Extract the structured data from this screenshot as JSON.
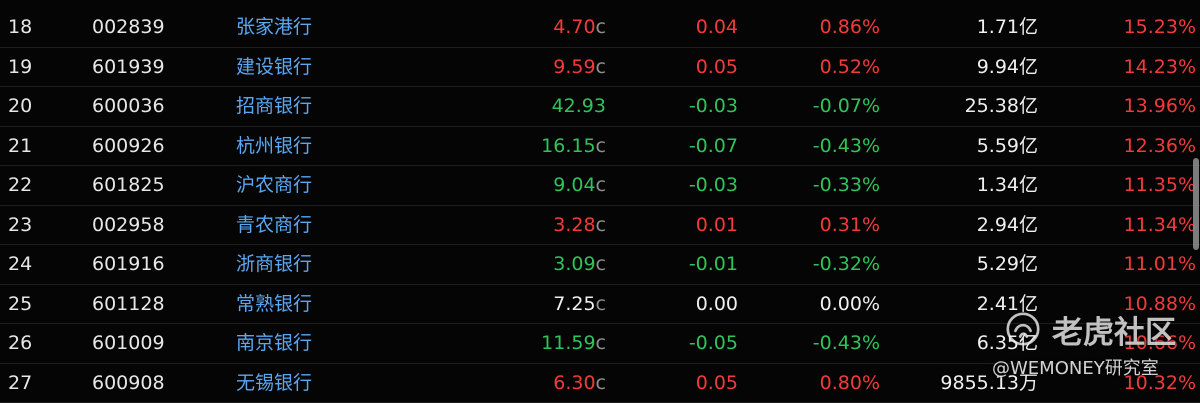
{
  "rows": [
    {
      "rank": "18",
      "code": "002839",
      "name": "张家港行",
      "price": "4.70",
      "price_suffix": "c",
      "change": "0.04",
      "pct": "0.86%",
      "amount": "1.71亿",
      "turnover": "15.23%",
      "price_trend": "up",
      "change_trend": "up",
      "pct_trend": "up",
      "turnover_trend": "up"
    },
    {
      "rank": "19",
      "code": "601939",
      "name": "建设银行",
      "price": "9.59",
      "price_suffix": "c",
      "change": "0.05",
      "pct": "0.52%",
      "amount": "9.94亿",
      "turnover": "14.23%",
      "price_trend": "up",
      "change_trend": "up",
      "pct_trend": "up",
      "turnover_trend": "up"
    },
    {
      "rank": "20",
      "code": "600036",
      "name": "招商银行",
      "price": "42.93",
      "price_suffix": "",
      "change": "-0.03",
      "pct": "-0.07%",
      "amount": "25.38亿",
      "turnover": "13.96%",
      "price_trend": "down",
      "change_trend": "down",
      "pct_trend": "down",
      "turnover_trend": "up"
    },
    {
      "rank": "21",
      "code": "600926",
      "name": "杭州银行",
      "price": "16.15",
      "price_suffix": "c",
      "change": "-0.07",
      "pct": "-0.43%",
      "amount": "5.59亿",
      "turnover": "12.36%",
      "price_trend": "down",
      "change_trend": "down",
      "pct_trend": "down",
      "turnover_trend": "up"
    },
    {
      "rank": "22",
      "code": "601825",
      "name": "沪农商行",
      "price": "9.04",
      "price_suffix": "c",
      "change": "-0.03",
      "pct": "-0.33%",
      "amount": "1.34亿",
      "turnover": "11.35%",
      "price_trend": "down",
      "change_trend": "down",
      "pct_trend": "down",
      "turnover_trend": "up"
    },
    {
      "rank": "23",
      "code": "002958",
      "name": "青农商行",
      "price": "3.28",
      "price_suffix": "c",
      "change": "0.01",
      "pct": "0.31%",
      "amount": "2.94亿",
      "turnover": "11.34%",
      "price_trend": "up",
      "change_trend": "up",
      "pct_trend": "up",
      "turnover_trend": "up"
    },
    {
      "rank": "24",
      "code": "601916",
      "name": "浙商银行",
      "price": "3.09",
      "price_suffix": "c",
      "change": "-0.01",
      "pct": "-0.32%",
      "amount": "5.29亿",
      "turnover": "11.01%",
      "price_trend": "down",
      "change_trend": "down",
      "pct_trend": "down",
      "turnover_trend": "up"
    },
    {
      "rank": "25",
      "code": "601128",
      "name": "常熟银行",
      "price": "7.25",
      "price_suffix": "c",
      "change": "0.00",
      "pct": "0.00%",
      "amount": "2.41亿",
      "turnover": "10.88%",
      "price_trend": "flat",
      "change_trend": "flat",
      "pct_trend": "flat",
      "turnover_trend": "up"
    },
    {
      "rank": "26",
      "code": "601009",
      "name": "南京银行",
      "price": "11.59",
      "price_suffix": "c",
      "change": "-0.05",
      "pct": "-0.43%",
      "amount": "6.35亿",
      "turnover": "10.66%",
      "price_trend": "down",
      "change_trend": "down",
      "pct_trend": "down",
      "turnover_trend": "up"
    },
    {
      "rank": "27",
      "code": "600908",
      "name": "无锡银行",
      "price": "6.30",
      "price_suffix": "c",
      "change": "0.05",
      "pct": "0.80%",
      "amount": "9855.13万",
      "turnover": "10.32%",
      "price_trend": "up",
      "change_trend": "up",
      "pct_trend": "up",
      "turnover_trend": "up"
    }
  ],
  "watermark": {
    "brand": "老虎社区",
    "author": "@WEMONEY研究室",
    "icon": "tiger-community-logo-icon"
  },
  "colors": {
    "background": "#050505",
    "text": "#e7e7e7",
    "stock_name": "#5aa7f2",
    "up": "#f23a3a",
    "down": "#2fc45a",
    "flat": "#f0f0f0"
  }
}
